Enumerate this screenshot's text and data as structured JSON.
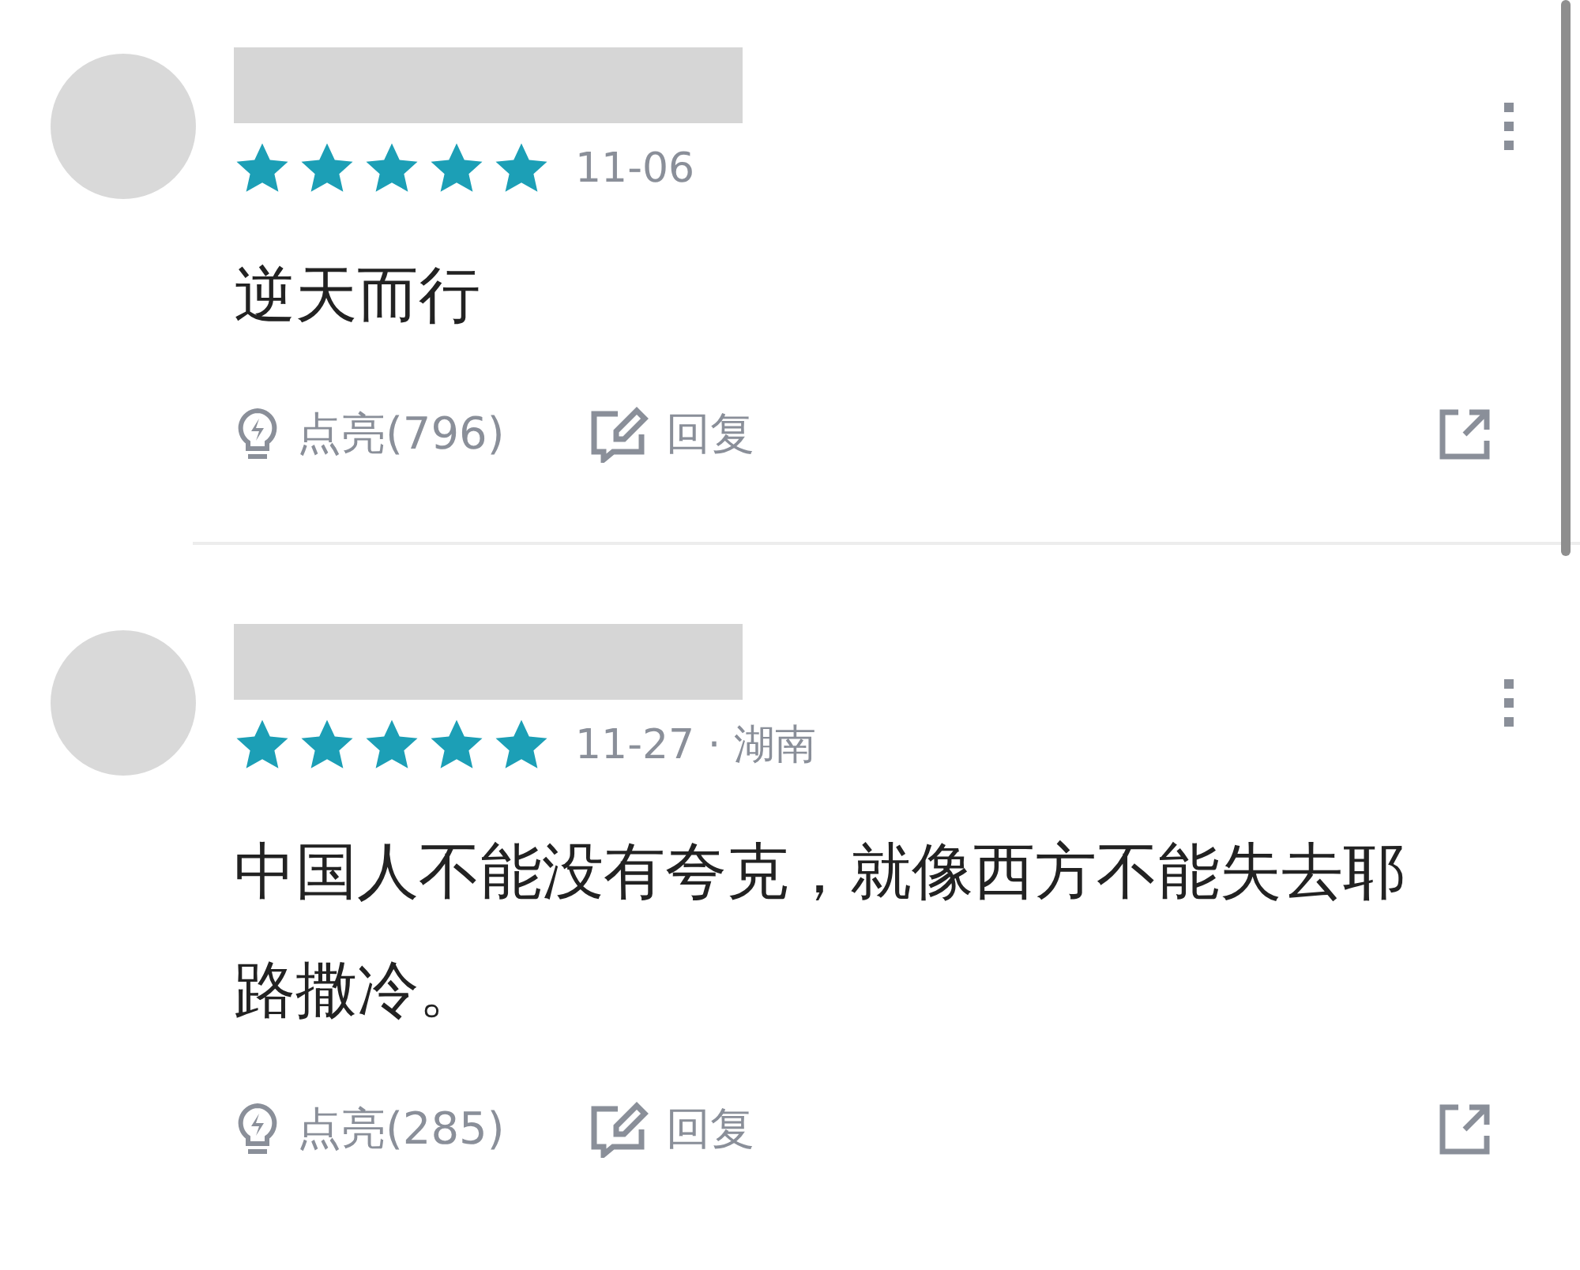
{
  "comments": [
    {
      "stars": 5,
      "meta": "11-06",
      "body": "逆天而行",
      "like": "点亮(796)",
      "reply": "回复"
    },
    {
      "stars": 5,
      "meta": "11-27 · 湖南",
      "body": "中国人不能没有夸克，就像西方不能失去耶路撒冷。",
      "like": "点亮(285)",
      "reply": "回复"
    }
  ]
}
